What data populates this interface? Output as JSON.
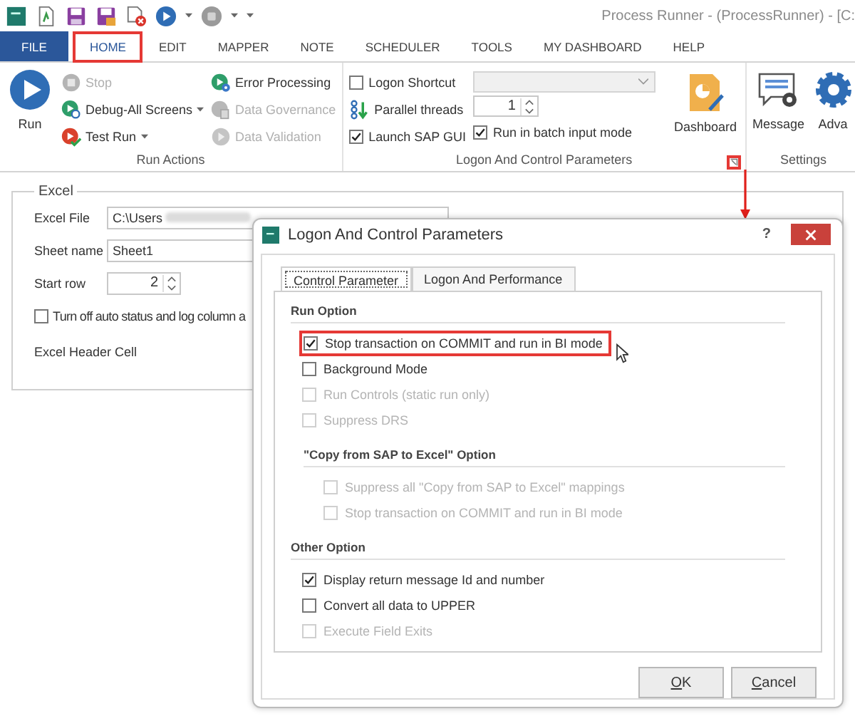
{
  "window": {
    "title": "Process Runner - (ProcessRunner) - [C:"
  },
  "tabs": [
    {
      "label": "FILE",
      "kind": "file",
      "selected": false,
      "highlighted": false
    },
    {
      "label": "HOME",
      "kind": "tab",
      "selected": true,
      "highlighted": true
    },
    {
      "label": "EDIT",
      "kind": "tab",
      "selected": false,
      "highlighted": false
    },
    {
      "label": "MAPPER",
      "kind": "tab",
      "selected": false,
      "highlighted": false
    },
    {
      "label": "NOTE",
      "kind": "tab",
      "selected": false,
      "highlighted": false
    },
    {
      "label": "SCHEDULER",
      "kind": "tab",
      "selected": false,
      "highlighted": false
    },
    {
      "label": "TOOLS",
      "kind": "tab",
      "selected": false,
      "highlighted": false
    },
    {
      "label": "MY DASHBOARD",
      "kind": "tab",
      "selected": false,
      "highlighted": false
    },
    {
      "label": "HELP",
      "kind": "tab",
      "selected": false,
      "highlighted": false
    }
  ],
  "run_actions": {
    "label": "Run Actions",
    "run": {
      "label": "Run"
    },
    "columns": [
      [
        {
          "label": "Stop",
          "kind": "stop",
          "disabled": true,
          "dropdown": false
        },
        {
          "label": "Debug-All Screens",
          "kind": "debug",
          "disabled": false,
          "dropdown": true
        },
        {
          "label": "Test Run",
          "kind": "test",
          "disabled": false,
          "dropdown": true
        }
      ],
      [
        {
          "label": "Error Processing",
          "kind": "error",
          "disabled": false,
          "dropdown": false
        },
        {
          "label": "Data Governance",
          "kind": "governance",
          "disabled": true,
          "dropdown": false
        },
        {
          "label": "Data Validation",
          "kind": "validation",
          "disabled": true,
          "dropdown": false
        }
      ]
    ]
  },
  "logon_group": {
    "label": "Logon And Control Parameters",
    "launcher_highlighted": true,
    "logon_shortcut": {
      "label": "Logon Shortcut",
      "checked": false
    },
    "shortcut_dropdown": {
      "disabled": true
    },
    "parallel_threads": {
      "label": "Parallel threads",
      "value": "1"
    },
    "launch_sap_gui": {
      "label": "Launch SAP GUI",
      "checked": true
    },
    "batch_input": {
      "label": "Run in batch input mode",
      "checked": true
    },
    "dashboard": {
      "label": "Dashboard"
    }
  },
  "settings_group": {
    "label": "Settings",
    "items": [
      {
        "label": "Message",
        "kind": "message"
      },
      {
        "label": "Adva",
        "kind": "gear"
      }
    ]
  },
  "excel": {
    "title": "Excel",
    "file": {
      "label": "Excel File",
      "value": "C:\\Users",
      "redacted": true
    },
    "sheet": {
      "label": "Sheet name",
      "value": "Sheet1"
    },
    "start_row": {
      "label": "Start row",
      "value": "2"
    },
    "auto_status": {
      "label": "Turn off auto status and log column a",
      "checked": false
    },
    "header_cell": {
      "label": "Excel Header Cell"
    }
  },
  "dialog": {
    "title": "Logon And Control Parameters",
    "help": "?",
    "tabs": [
      {
        "label": "Control Parameter",
        "selected": true
      },
      {
        "label": "Logon And Performance",
        "selected": false
      }
    ],
    "sections": [
      {
        "title": "Run Option",
        "indented": false,
        "options": [
          {
            "label": "Stop transaction on COMMIT and run in BI mode",
            "checked": true,
            "disabled": false,
            "highlighted": true
          },
          {
            "label": "Background Mode",
            "checked": false,
            "disabled": false,
            "highlighted": false
          },
          {
            "label": "Run Controls (static run only)",
            "checked": false,
            "disabled": true,
            "highlighted": false
          },
          {
            "label": "Suppress DRS",
            "checked": false,
            "disabled": true,
            "highlighted": false
          }
        ]
      },
      {
        "title": "\"Copy from SAP to Excel\" Option",
        "indented": true,
        "options": [
          {
            "label": "Suppress all \"Copy from SAP to Excel\" mappings",
            "checked": false,
            "disabled": true,
            "highlighted": false
          },
          {
            "label": "Stop transaction on COMMIT and run in BI mode",
            "checked": false,
            "disabled": true,
            "highlighted": false
          }
        ]
      },
      {
        "title": "Other Option",
        "indented": false,
        "options": [
          {
            "label": "Display return message Id and number",
            "checked": true,
            "disabled": false,
            "highlighted": false
          },
          {
            "label": "Convert all data to UPPER",
            "checked": false,
            "disabled": false,
            "highlighted": false
          },
          {
            "label": "Execute Field Exits",
            "checked": false,
            "disabled": true,
            "highlighted": false
          }
        ]
      }
    ],
    "buttons": [
      {
        "label": "OK"
      },
      {
        "label": "Cancel"
      }
    ]
  }
}
